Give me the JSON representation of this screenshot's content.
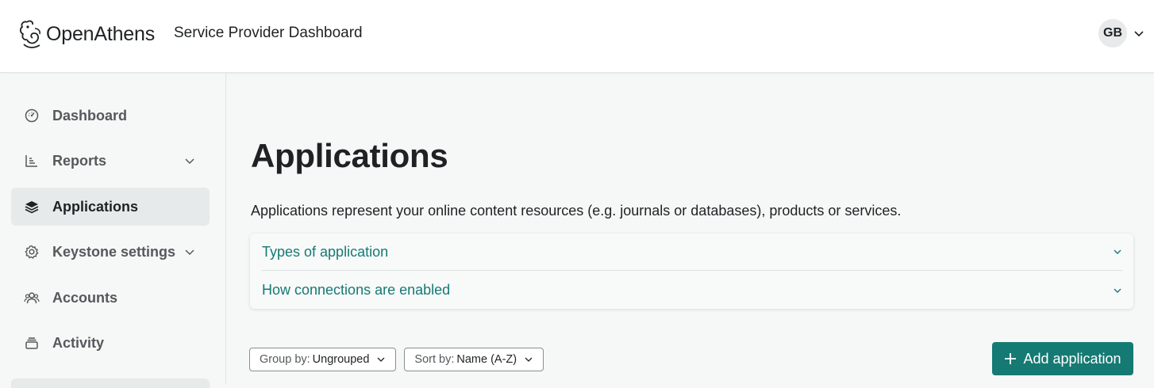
{
  "header": {
    "logo_text": "OpenAthens",
    "app_title": "Service Provider Dashboard",
    "user_initials": "GB",
    "logo_icon": "openathens-owl-logo",
    "user_menu_icon": "chevron-down-icon"
  },
  "sidebar": {
    "items": [
      {
        "label": "Dashboard",
        "icon": "gauge-icon",
        "active": false,
        "expandable": false
      },
      {
        "label": "Reports",
        "icon": "bar-chart-icon",
        "active": false,
        "expandable": true
      },
      {
        "label": "Applications",
        "icon": "layers-icon",
        "active": true,
        "expandable": false
      },
      {
        "label": "Keystone settings",
        "icon": "gear-icon",
        "active": false,
        "expandable": true
      },
      {
        "label": "Accounts",
        "icon": "users-icon",
        "active": false,
        "expandable": false
      },
      {
        "label": "Activity",
        "icon": "stack-icon",
        "active": false,
        "expandable": false
      }
    ]
  },
  "main": {
    "title": "Applications",
    "description": "Applications represent your online content resources (e.g. journals or databases), products or services.",
    "accordion": [
      {
        "label": "Types of application",
        "expanded": false
      },
      {
        "label": "How connections are enabled",
        "expanded": false
      }
    ],
    "group_by": {
      "label": "Group by:",
      "value": "Ungrouped"
    },
    "sort_by": {
      "label": "Sort by:",
      "value": "Name (A-Z)"
    },
    "add_button_label": "Add application"
  },
  "colors": {
    "accent": "#157a73",
    "active_nav_bg": "#e7eaea",
    "page_bg": "#f6f7f7"
  }
}
